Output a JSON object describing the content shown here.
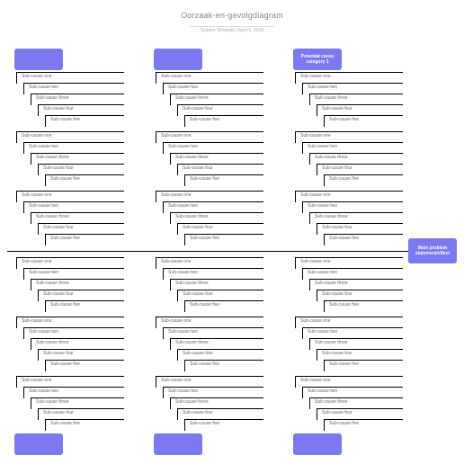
{
  "header": {
    "title": "Oorzaak-en-gevolgdiagram",
    "subtitle": "System Template  |  April 6, 2018"
  },
  "effect": {
    "label": "Main problem statement/effect"
  },
  "categories": {
    "top": [
      {
        "label": ""
      },
      {
        "label": ""
      },
      {
        "label": "Potential cause category 1"
      }
    ],
    "bottom": [
      {
        "label": ""
      },
      {
        "label": ""
      },
      {
        "label": ""
      }
    ]
  },
  "subcauses": [
    "Sub-cause one",
    "Sub-cause two",
    "Sub-cause three",
    "Sub-cause four",
    "Sub-cause five"
  ],
  "colors": {
    "accent": "#7a79f2"
  }
}
